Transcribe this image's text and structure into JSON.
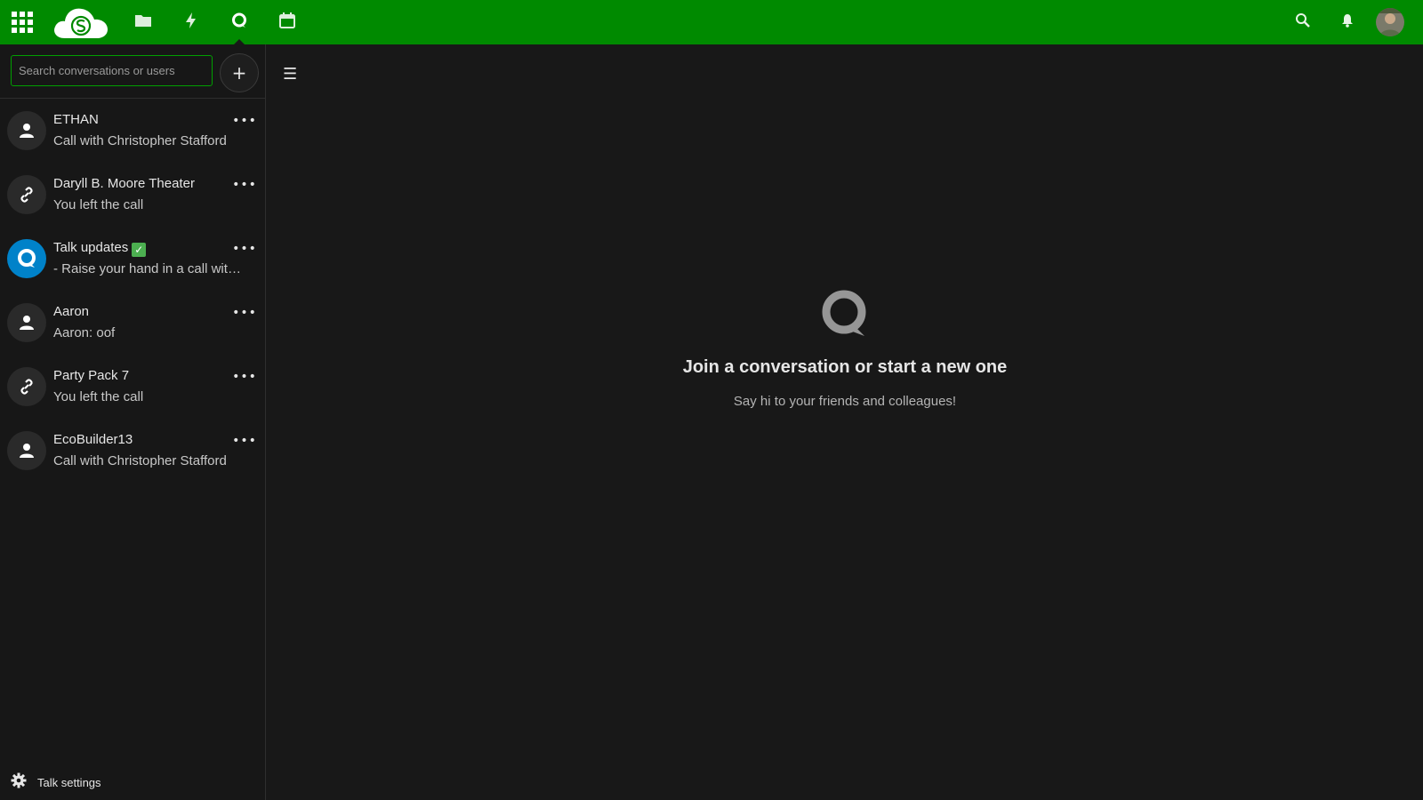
{
  "header": {
    "nav": [
      {
        "name": "files",
        "icon": "folder-icon"
      },
      {
        "name": "activity",
        "icon": "lightning-icon"
      },
      {
        "name": "talk",
        "icon": "talk-icon",
        "active": true
      },
      {
        "name": "calendar",
        "icon": "calendar-icon"
      }
    ],
    "brand_color": "#008a00"
  },
  "sidebar": {
    "search_placeholder": "Search conversations or users",
    "new_label": "+",
    "conversations": [
      {
        "name": "ETHAN",
        "subtitle": "Call with Christopher Stafford",
        "avatar": "user-icon"
      },
      {
        "name": "Daryll B. Moore Theater",
        "subtitle": "You left the call",
        "avatar": "link-icon"
      },
      {
        "name": "Talk updates",
        "subtitle": "- Raise your hand in a call with the R key",
        "avatar": "talk-icon",
        "verified": true
      },
      {
        "name": "Aaron",
        "subtitle": "Aaron: oof",
        "avatar": "user-icon"
      },
      {
        "name": "Party Pack 7",
        "subtitle": "You left the call",
        "avatar": "link-icon"
      },
      {
        "name": "EcoBuilder13",
        "subtitle": "Call with Christopher Stafford",
        "avatar": "user-icon"
      }
    ],
    "more_label": "•••",
    "check_mark": "✓",
    "settings_label": "Talk settings"
  },
  "main": {
    "menu_glyph": "☰",
    "empty_title": "Join a conversation or start a new one",
    "empty_subtitle": "Say hi to your friends and colleagues!"
  }
}
